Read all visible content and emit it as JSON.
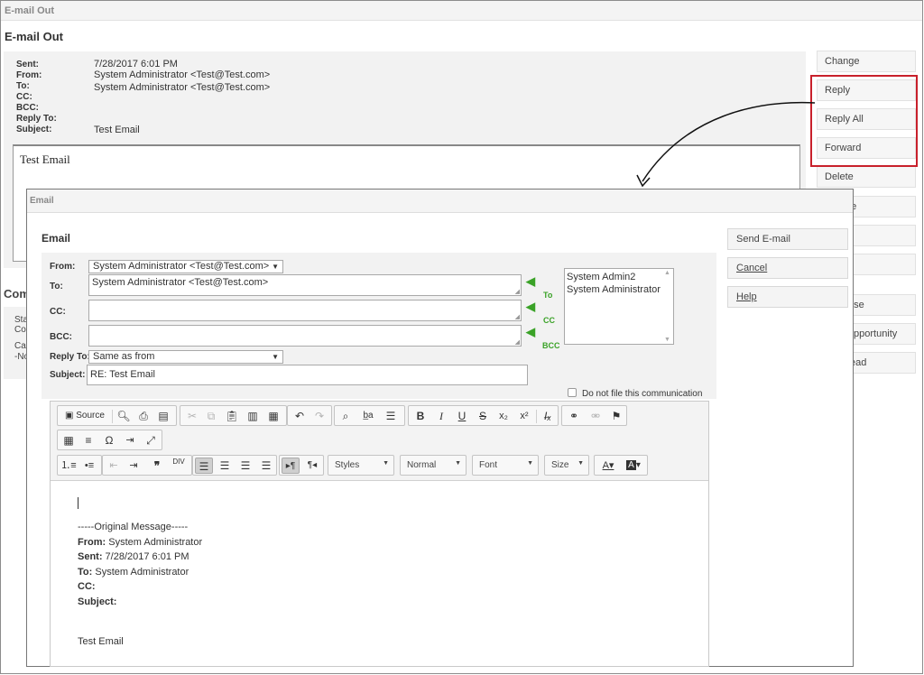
{
  "background_window": {
    "titlebar": "E-mail Out",
    "heading": "E-mail Out",
    "headers": [
      {
        "label": "Sent:",
        "value": "7/28/2017  6:01 PM"
      },
      {
        "label": "From:",
        "value": "System Administrator <Test@Test.com>"
      },
      {
        "label": "To:",
        "value": "System Administrator <Test@Test.com>"
      },
      {
        "label": "CC:",
        "value": ""
      },
      {
        "label": "BCC:",
        "value": ""
      },
      {
        "label": "Reply To:",
        "value": ""
      },
      {
        "label": "Subject:",
        "value": "Test Email"
      }
    ],
    "body_text": "Test Email",
    "fragment_section": "Com",
    "fragment_lines": [
      "Sta",
      "Co",
      "Car",
      "-No"
    ],
    "buttons": [
      "Change",
      "Reply",
      "Reply All",
      "Forward",
      "Delete",
      "ue",
      "l",
      "",
      "ase",
      "pportunity",
      "ead"
    ]
  },
  "dialog": {
    "titlebar": "Email",
    "heading": "Email",
    "from_label": "From:",
    "from_value": "System Administrator <Test@Test.com>",
    "to_label": "To:",
    "to_value": "System Administrator <Test@Test.com>",
    "cc_label": "CC:",
    "cc_value": "",
    "bcc_label": "BCC:",
    "bcc_value": "",
    "reply_to_label": "Reply To:",
    "reply_to_value": "Same as from",
    "subject_label": "Subject:",
    "subject_value": "RE: Test Email",
    "add_to_label": "To",
    "add_cc_label": "CC",
    "add_bcc_label": "BCC",
    "recipients": [
      "System Admin2",
      "System Administrator"
    ],
    "do_not_file_label": "Do not file this communication",
    "buttons": {
      "send": "Send E-mail",
      "cancel": "Cancel",
      "help": "Help"
    },
    "caret_glyph": "▼"
  },
  "editor": {
    "source_label": "Source",
    "combos": {
      "styles": "Styles",
      "format": "Normal",
      "font": "Font",
      "size": "Size"
    },
    "content": {
      "separator": "-----Original Message-----",
      "from_label": "From:",
      "from_value": " System Administrator",
      "sent_label": "Sent:",
      "sent_value": " 7/28/2017 6:01 PM",
      "to_label": "To:",
      "to_value": " System Administrator",
      "cc_label": "CC:",
      "subject_label": "Subject:",
      "body": "Test Email"
    }
  },
  "colors": {
    "highlight": "#c8202b",
    "green_arrows": "#3aa227"
  }
}
